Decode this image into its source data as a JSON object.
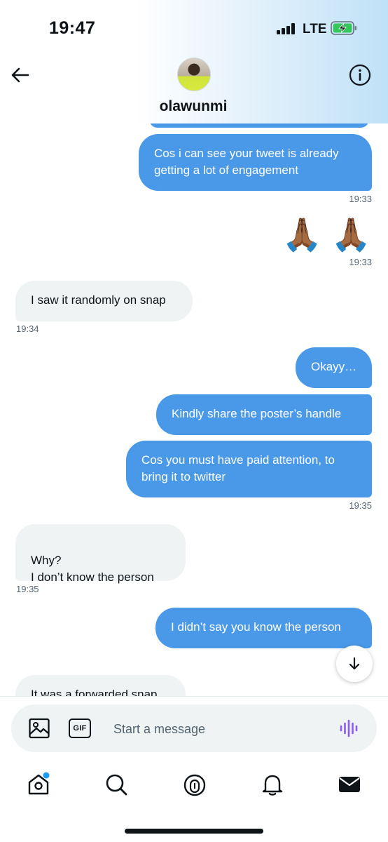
{
  "status_bar": {
    "time": "19:47",
    "network": "LTE"
  },
  "header": {
    "contact_name": "olawunmi",
    "back_icon": "arrow-left-icon",
    "info_icon": "info-icon"
  },
  "messages": [
    {
      "dir": "out",
      "text": "Cos i can see your tweet is already getting a lot of engagement",
      "time": "19:33"
    },
    {
      "dir": "out",
      "text": "🙏🏾 🙏🏾",
      "time": "19:33"
    },
    {
      "dir": "in",
      "text": "I saw it randomly on snap",
      "time": "19:34"
    },
    {
      "dir": "out",
      "text": "Okayy…"
    },
    {
      "dir": "out",
      "text": "Kindly share the poster’s handle"
    },
    {
      "dir": "out",
      "text": "Cos you must have paid attention, to bring it to twitter",
      "time": "19:35"
    },
    {
      "dir": "in",
      "text": "Why?\n I don’t know the person",
      "time": "19:35"
    },
    {
      "dir": "out",
      "text": "I didn’t say you know the person"
    },
    {
      "dir": "in",
      "text": "It was a forwarded snap"
    }
  ],
  "composer": {
    "placeholder": "Start a message",
    "gif_label": "GIF"
  },
  "tabbar": {
    "items": [
      "home-icon",
      "search-icon",
      "spaces-icon",
      "notifications-icon",
      "messages-icon"
    ],
    "home_has_dot": true
  },
  "colors": {
    "outgoing_bubble": "#4a99e9",
    "incoming_bubble": "#eff3f4",
    "accent": "#1d9bf0",
    "voice_icon": "#8a5cf5"
  }
}
